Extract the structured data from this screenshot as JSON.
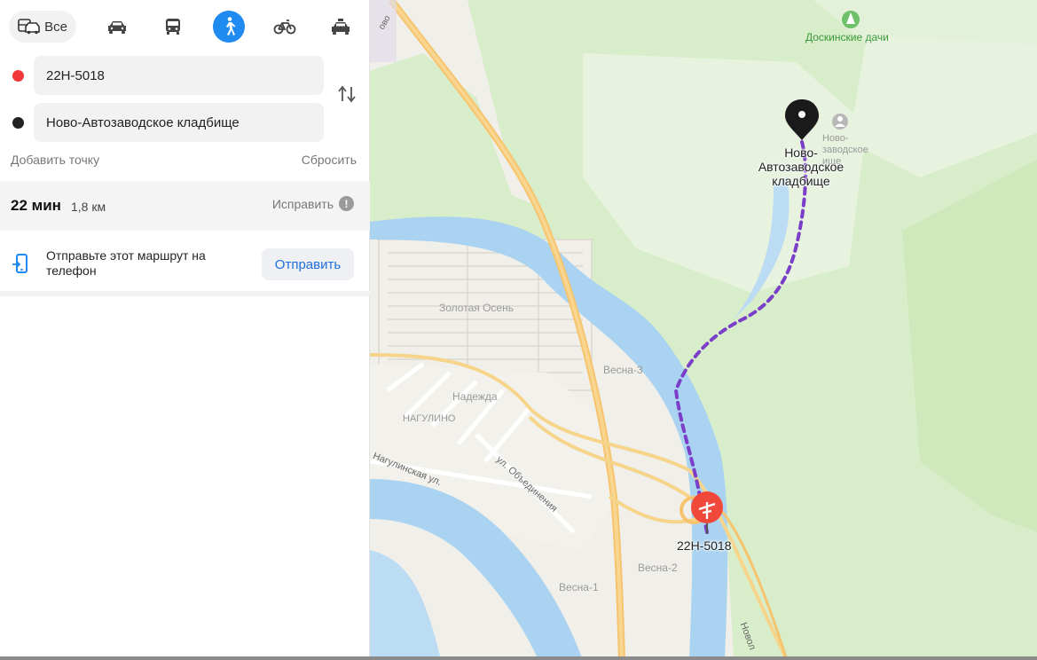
{
  "transport_modes": {
    "all_label": "Все",
    "modes": [
      {
        "name": "all",
        "icon": "car-bus-icon",
        "active": false
      },
      {
        "name": "car",
        "icon": "car-icon",
        "active": false
      },
      {
        "name": "transit",
        "icon": "bus-icon",
        "active": false
      },
      {
        "name": "walk",
        "icon": "pedestrian-icon",
        "active": true
      },
      {
        "name": "bike",
        "icon": "bicycle-icon",
        "active": false
      },
      {
        "name": "taxi",
        "icon": "taxi-icon",
        "active": false
      }
    ]
  },
  "route": {
    "from": {
      "value": "22Н-5018",
      "dot_color": "#f0383a"
    },
    "to": {
      "value": "Ново-Автозаводское кладбище",
      "dot_color": "#222222"
    },
    "add_point": "Добавить точку",
    "reset": "Сбросить"
  },
  "summary": {
    "time": "22 мин",
    "distance": "1,8 км",
    "fix": "Исправить",
    "fix_icon": "!"
  },
  "send": {
    "text": "Отправьте этот маршрут на телефон",
    "button": "Отправить"
  },
  "map": {
    "labels": {
      "dachi": "Доскинские дачи",
      "zolotaya_osen": "Золотая Осень",
      "vesna3": "Весна-3",
      "nadezhda": "Надежда",
      "nagulino": "НАГУЛИНО",
      "nagulinskaya": "Нагулинская ул.",
      "obedineniya": "ул. Объединения",
      "vesna1": "Весна-1",
      "vesna2": "Весна-2",
      "novo_small": "Ново-\nзаводское\nище",
      "novo_edge": "Новол",
      "road_top": "ово"
    },
    "destination_label": "Ново-\nАвтозаводское\nкладбище",
    "start_label": "22Н-5018",
    "route_color": "#7a3ec9",
    "start_pin_color": "#f0483a",
    "end_pin_color": "#1a1a1a"
  }
}
